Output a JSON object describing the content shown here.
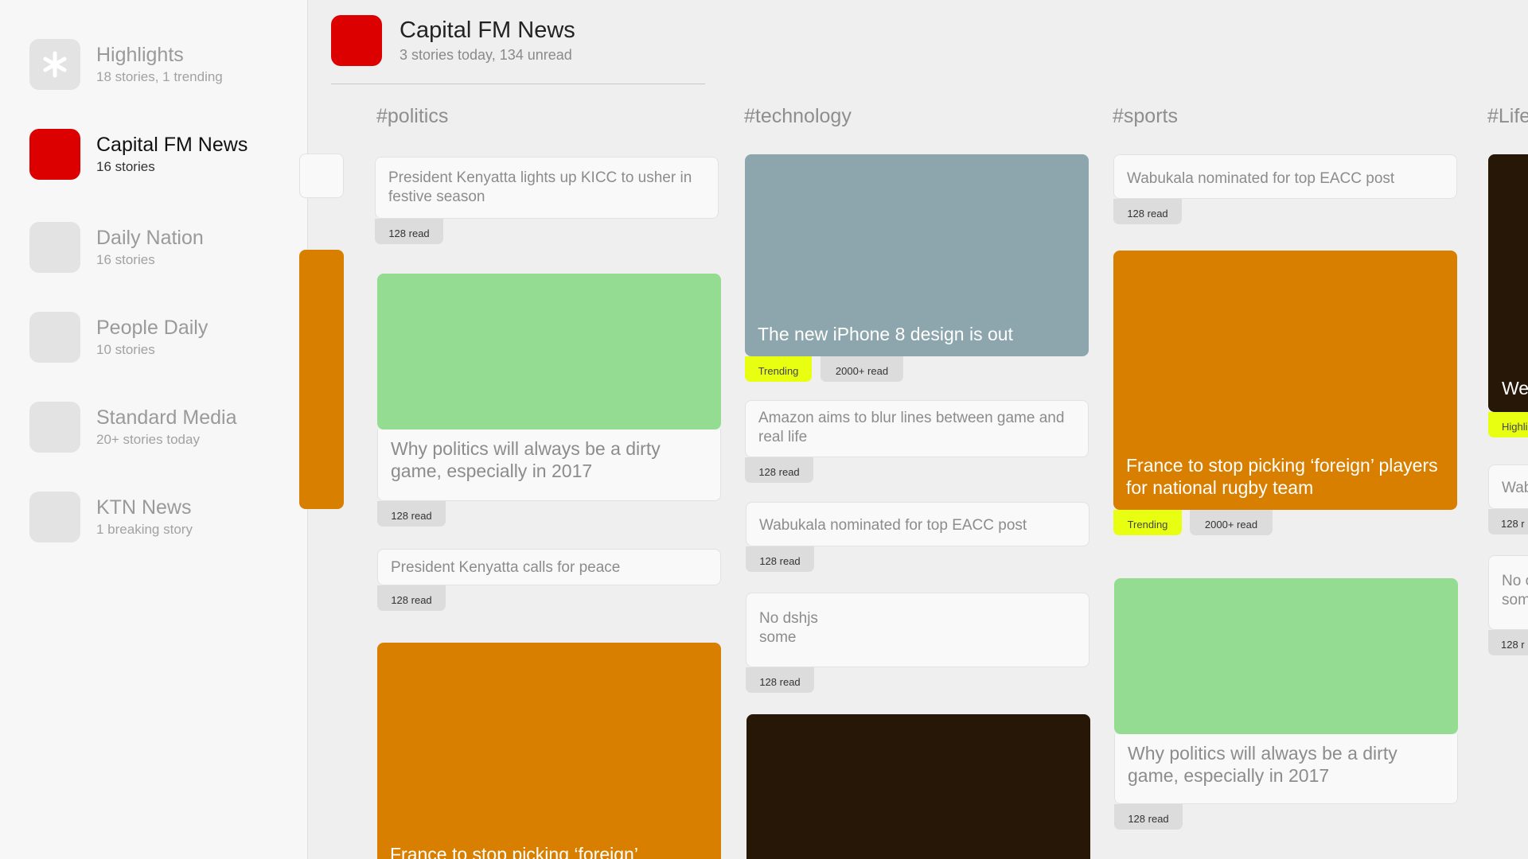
{
  "sidebar": {
    "items": [
      {
        "name": "Highlights",
        "sub": "18 stories, 1 trending"
      },
      {
        "name": "Capital FM News",
        "sub": "16 stories"
      },
      {
        "name": "Daily Nation",
        "sub": "16 stories"
      },
      {
        "name": "People Daily",
        "sub": "10 stories"
      },
      {
        "name": "Standard Media",
        "sub": "20+ stories today"
      },
      {
        "name": "KTN News",
        "sub": "1 breaking story"
      }
    ]
  },
  "header": {
    "title": "Capital FM News",
    "subtitle": "3 stories today, 134 unread"
  },
  "columns": {
    "politics": {
      "title": "#politics",
      "cards": [
        {
          "text": "President Kenyatta lights up KICC to usher in festive season",
          "read": "128 read"
        },
        {
          "text": "Why politics will always be a dirty game, especially in 2017",
          "read": "128 read"
        },
        {
          "text": "President Kenyatta calls for peace",
          "read": "128 read"
        },
        {
          "text": "France to stop picking ‘foreign’"
        }
      ]
    },
    "technology": {
      "title": "#technology",
      "cards": [
        {
          "text": "The new iPhone 8 design is out",
          "trend": "Trending",
          "read": "2000+ read"
        },
        {
          "text": "Amazon aims to blur lines between game and real life",
          "read": "128 read"
        },
        {
          "text": "Wabukala nominated for top EACC post",
          "read": "128 read"
        },
        {
          "text": "No dshjs\nsome",
          "read": "128 read"
        }
      ]
    },
    "sports": {
      "title": "#sports",
      "cards": [
        {
          "text": "Wabukala nominated for top EACC post",
          "read": "128 read"
        },
        {
          "text": "France to stop picking ‘foreign’ players for national rugby team",
          "trend": "Trending",
          "read": "2000+ read"
        },
        {
          "text": "Why politics will always be a dirty game, especially in 2017",
          "read": "128 read"
        }
      ]
    },
    "lifestyle": {
      "title": "#Life",
      "cards": [
        {
          "text": "We",
          "trend": "Highli"
        },
        {
          "text": "Wab",
          "read": "128 r"
        },
        {
          "text": "No c\nsom",
          "read": "128 r"
        }
      ]
    }
  },
  "colors": {
    "red": "#dd0000",
    "orange": "#d97f00",
    "green": "#94dc92",
    "slate": "#8da6ad",
    "dark": "#261706",
    "trend": "#e8ff12"
  },
  "icons": {
    "highlights": "asterisk-icon"
  }
}
